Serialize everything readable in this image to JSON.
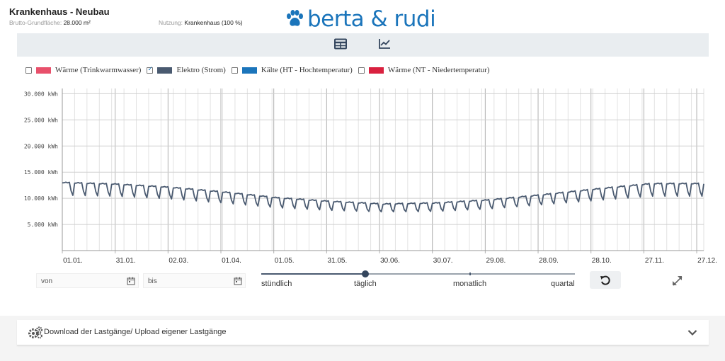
{
  "header": {
    "title": "Krankenhaus - Neubau",
    "area_label": "Brutto-Grundfläche:",
    "area_value": "28.000 m²",
    "usage_label": "Nutzung:",
    "usage_value": "Krankenhaus (100 %)",
    "logo_text": "berta & rudi",
    "brand_color": "#1b75bb"
  },
  "toolbar": {
    "table_view_icon": "table-icon",
    "chart_view_icon": "line-chart-icon"
  },
  "legend": [
    {
      "label": "Wärme (Trinkwarmwasser)",
      "color": "#e8506b",
      "checked": false
    },
    {
      "label": "Elektro (Strom)",
      "color": "#4a5a70",
      "checked": true
    },
    {
      "label": "Kälte (HT - Hochtemperatur)",
      "color": "#1b75bb",
      "checked": false
    },
    {
      "label": "Wärme (NT - Niedertemperatur)",
      "color": "#d9213f",
      "checked": false
    }
  ],
  "chart_data": {
    "type": "line",
    "series": [
      {
        "name": "Elektro (Strom)",
        "color": "#4a5a70"
      }
    ],
    "y_ticks": [
      "30.000 kWh",
      "25.000 kWh",
      "20.000 kWh",
      "15.000 kWh",
      "10.000 kWh",
      "5.000 kWh"
    ],
    "y_tick_values": [
      30000,
      25000,
      20000,
      15000,
      10000,
      5000
    ],
    "ylim": [
      0,
      31000
    ],
    "x_ticks": [
      "01.01.",
      "31.01.",
      "02.03.",
      "01.04.",
      "01.05.",
      "31.05.",
      "30.06.",
      "30.07.",
      "29.08.",
      "28.09.",
      "28.10.",
      "27.11.",
      "27.12."
    ],
    "x_tick_days": [
      0,
      30,
      60,
      90,
      120,
      150,
      180,
      210,
      240,
      270,
      300,
      330,
      360
    ],
    "x_range_days": [
      0,
      364
    ],
    "resolution": "täglich",
    "weekly_profile_note": "weekday high / weekend low",
    "monthly_weekday_kwh": [
      13100,
      12800,
      12200,
      11300,
      10200,
      9500,
      9000,
      9200,
      9800,
      10800,
      11900,
      12900
    ],
    "monthly_weekend_kwh": [
      10600,
      10400,
      9900,
      9100,
      8200,
      7700,
      7400,
      7500,
      8000,
      8800,
      9600,
      10400
    ]
  },
  "controls": {
    "from_placeholder": "von",
    "to_placeholder": "bis",
    "resolution_options": [
      "stündlich",
      "täglich",
      "monatlich",
      "quartal"
    ],
    "resolution_selected": "täglich",
    "reset_icon": "reset-icon",
    "expand_icon": "expand-icon"
  },
  "download": {
    "label": "Download der Lastgänge/ Upload eigener Lastgänge",
    "icon": "gears-icon",
    "chevron": "chevron-down-icon"
  }
}
